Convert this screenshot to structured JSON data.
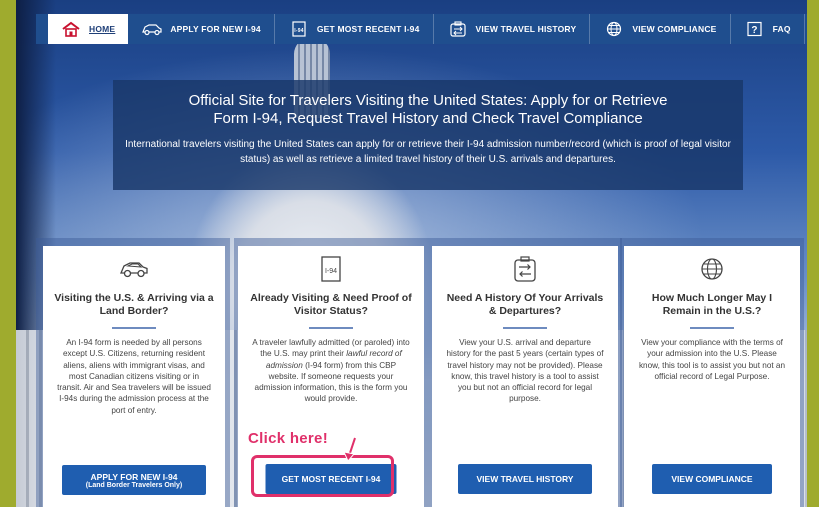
{
  "nav": {
    "items": [
      {
        "label": "HOME",
        "icon": "home-icon"
      },
      {
        "label": "APPLY FOR NEW I-94",
        "icon": "car-icon"
      },
      {
        "label": "GET MOST RECENT I-94",
        "icon": "i94-doc-icon"
      },
      {
        "label": "VIEW TRAVEL HISTORY",
        "icon": "travel-history-icon"
      },
      {
        "label": "VIEW COMPLIANCE",
        "icon": "globe-icon"
      },
      {
        "label": "FAQ",
        "icon": "question-icon"
      }
    ]
  },
  "hero": {
    "title": "Official Site for Travelers Visiting the United States: Apply for or Retrieve Form I-94, Request Travel History and Check Travel Compliance",
    "description": "International travelers visiting the United States can apply for or retrieve their I-94 admission number/record (which is proof of legal visitor status) as well as retrieve a limited travel history of their U.S. arrivals and departures."
  },
  "cards": [
    {
      "icon": "car-icon",
      "title": "Visiting the U.S. & Arriving via a Land Border?",
      "body": "An I-94 form is needed by all persons except U.S. Citizens, returning resident aliens, aliens with immigrant visas, and most Canadian citizens visiting or in transit. Air and Sea travelers will be issued I-94s during the admission process at the port of entry.",
      "button": "APPLY FOR NEW I-94",
      "button_sub": "(Land Border Travelers Only)"
    },
    {
      "icon": "i94-doc-icon",
      "icon_text": "I-94",
      "title": "Already Visiting & Need Proof of Visitor Status?",
      "body_pre": "A traveler lawfully admitted (or paroled) into the U.S. may print their ",
      "body_em": "lawful record of admission",
      "body_post": " (I-94 form) from this CBP website. If someone requests your admission information, this is the form you would provide.",
      "button": "GET MOST RECENT I-94"
    },
    {
      "icon": "travel-history-icon",
      "title": "Need A History Of Your Arrivals & Departures?",
      "body": "View your U.S. arrival and departure history for the past 5 years (certain types of travel history may not be provided). Please know, this travel history is a tool to assist you but not an official record for legal purpose.",
      "button": "VIEW TRAVEL HISTORY"
    },
    {
      "icon": "globe-icon",
      "title": "How Much Longer May I Remain in the U.S.?",
      "body": "View your compliance with the terms of your admission into the U.S. Please know, this tool is to assist you but not an official record of Legal Purpose.",
      "button": "VIEW COMPLIANCE"
    }
  ],
  "annotation": {
    "text": "Click here!",
    "color": "#e0306a"
  },
  "colors": {
    "nav_bg": "#1f4e8e",
    "button_bg": "#1f5eb0",
    "page_border": "#9fab2e"
  }
}
